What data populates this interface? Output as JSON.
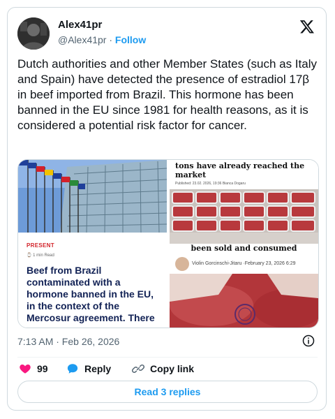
{
  "author": {
    "name": "Alex41pr",
    "handle": "@Alex41pr",
    "separator": "·",
    "follow_label": "Follow"
  },
  "tweet": {
    "text": "Dutch authorities and other Member States (such as Italy and Spain) have detected the presence of estradiol 17β in beef imported from Brazil. This hormone has been banned in the EU since 1981 for health reasons, as it is considered a potential risk factor for cancer.",
    "timestamp": "7:13 AM · Feb 26, 2026"
  },
  "media_left": {
    "section_label": "PRESENT",
    "read_time": "1 min Read",
    "headline": "Beef from Brazil contaminated with a hormone banned in the EU, in the context of the Mercosur agreement. There"
  },
  "media_right": {
    "top_text": "tons have already reached the market",
    "meta": "Published: 23.02. 2026, 19:36      Bianca Dogaru",
    "caption": "been sold and consumed",
    "byline": "Violin Gorcinschi-Jitaru ·February 23, 2026 6:29"
  },
  "actions": {
    "likes_count": "99",
    "reply_label": "Reply",
    "copy_link_label": "Copy link"
  },
  "read_replies_label": "Read 3 replies",
  "colors": {
    "accent": "#1d9bf0",
    "like": "#f91880",
    "secondary_text": "#536471",
    "border": "#cfd9de",
    "headline_navy": "#122255",
    "present_red": "#d2232a"
  },
  "icons": [
    "x-logo-icon",
    "heart-icon",
    "reply-bubble-icon",
    "link-icon",
    "info-icon"
  ]
}
